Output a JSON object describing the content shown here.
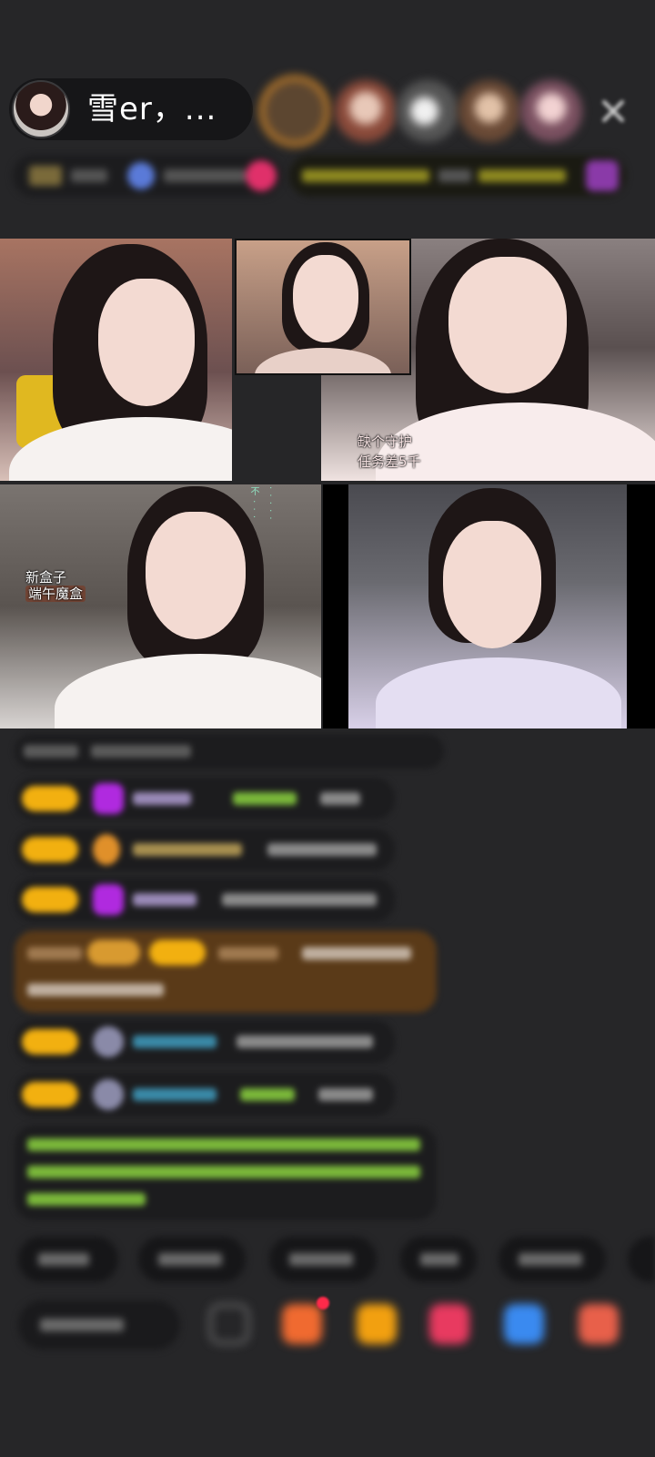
{
  "header": {
    "host_name": "雪er，...",
    "close_icon": "close-icon"
  },
  "video_grid": {
    "overlay_guard_line1": "缺个守护",
    "overlay_guard_line2": "任务差5千",
    "overlay_box_line1": "新盒子",
    "overlay_box_line2": "端午魔盒"
  },
  "colors": {
    "background": "#262628",
    "badge_gold": "#f2b010",
    "diamond_purple": "#b02adf",
    "highlight_green": "#7ab83a",
    "gift_banner_brown": "#5a3a18"
  }
}
